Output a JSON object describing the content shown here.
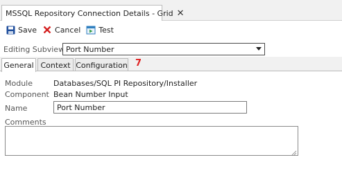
{
  "window": {
    "tab_title": "MSSQL Repository Connection Details - Grid",
    "close_glyph": "✕"
  },
  "toolbar": {
    "save_label": "Save",
    "cancel_label": "Cancel",
    "test_label": "Test"
  },
  "subview": {
    "label": "Editing Subview",
    "selected": "Port Number"
  },
  "tabs": [
    {
      "label": "General",
      "active": true
    },
    {
      "label": "Context",
      "active": false
    },
    {
      "label": "Configuration",
      "active": false
    }
  ],
  "annotation": "7",
  "details": {
    "module_label": "Module",
    "module_value": "Databases/SQL PI Repository/Installer",
    "component_label": "Component",
    "component_value": "Bean Number Input",
    "name_label": "Name",
    "name_value": "Port Number",
    "comments_label": "Comments",
    "comments_value": ""
  },
  "colors": {
    "save_icon": "#1f4e9c",
    "cancel_icon": "#d42020",
    "test_icon": "#2f7fbf",
    "annotation": "#e02020"
  },
  "icons": {
    "save": "save-icon",
    "cancel": "cancel-icon",
    "test": "test-icon",
    "dropdown": "chevron-down-icon",
    "resize": "resize-grip-icon"
  }
}
